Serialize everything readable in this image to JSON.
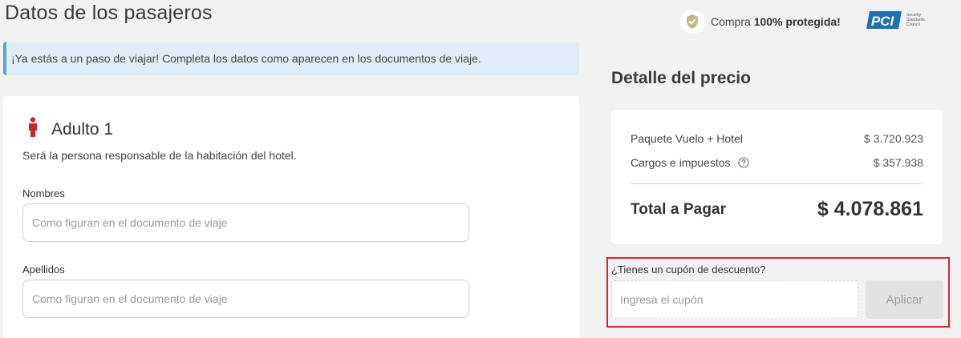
{
  "page": {
    "title": "Datos de los pasajeros"
  },
  "secure_badge": {
    "prefix": "Compra ",
    "strong": "100% protegida!",
    "icon": "shield-check-icon"
  },
  "pci_logo": {
    "mark": "PCI",
    "subtitle": "Security Standards Council"
  },
  "info_banner": {
    "text": "¡Ya estás a un paso de viajar! Completa los datos como aparecen en los documentos de viaje."
  },
  "passenger": {
    "title": "Adulto 1",
    "icon": "person-icon",
    "subtitle": "Será la persona responsable de la habitación del hotel.",
    "fields": {
      "first_name": {
        "label": "Nombres",
        "placeholder": "Como figuran en el documento de viaje",
        "value": ""
      },
      "last_name": {
        "label": "Apellidos",
        "placeholder": "Como figuran en el documento de viaje",
        "value": ""
      }
    }
  },
  "price_detail": {
    "title": "Detalle del precio",
    "lines": [
      {
        "label": "Paquete Vuelo + Hotel",
        "amount": "$ 3.720.923"
      },
      {
        "label": "Cargos e impuestos",
        "amount": "$ 357.938",
        "icon": "help-circle-icon"
      }
    ],
    "total_label": "Total a Pagar",
    "total_amount": "$ 4.078.861"
  },
  "coupon": {
    "label": "¿Tienes un cupón de descuento?",
    "placeholder": "Ingresa el cupón",
    "value": "",
    "button_label": "Aplicar"
  },
  "colors": {
    "accent_red": "#c62828",
    "banner_bg": "#dfeef6",
    "banner_border": "#5aa3c9",
    "highlight_border": "#d7282f",
    "pci_blue": "#1f6fb2"
  }
}
